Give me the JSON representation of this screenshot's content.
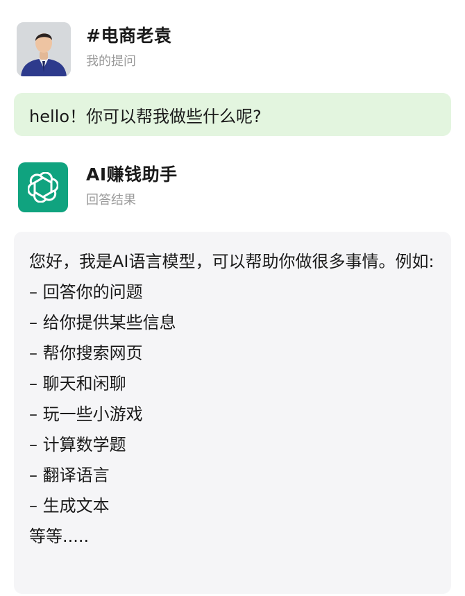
{
  "user": {
    "name": "#电商老袁",
    "subtitle": "我的提问"
  },
  "question": {
    "text": "hello！你可以帮我做些什么呢?"
  },
  "assistant": {
    "name": "AI赚钱助手",
    "subtitle": "回答结果",
    "icon": "openai-logo-icon",
    "accent_color": "#10a37f"
  },
  "answer": {
    "intro": "您好，我是AI语言模型，可以帮助你做很多事情。例如:",
    "items": [
      "– 回答你的问题",
      "– 给你提供某些信息",
      "– 帮你搜索网页",
      "– 聊天和闲聊",
      "– 玩一些小游戏",
      "– 计算数学题",
      "– 翻译语言",
      "– 生成文本"
    ],
    "outro": "等等....."
  },
  "colors": {
    "question_bubble": "#e3f5df",
    "answer_card": "#f5f5f7",
    "subtitle": "#9a9a9a"
  }
}
